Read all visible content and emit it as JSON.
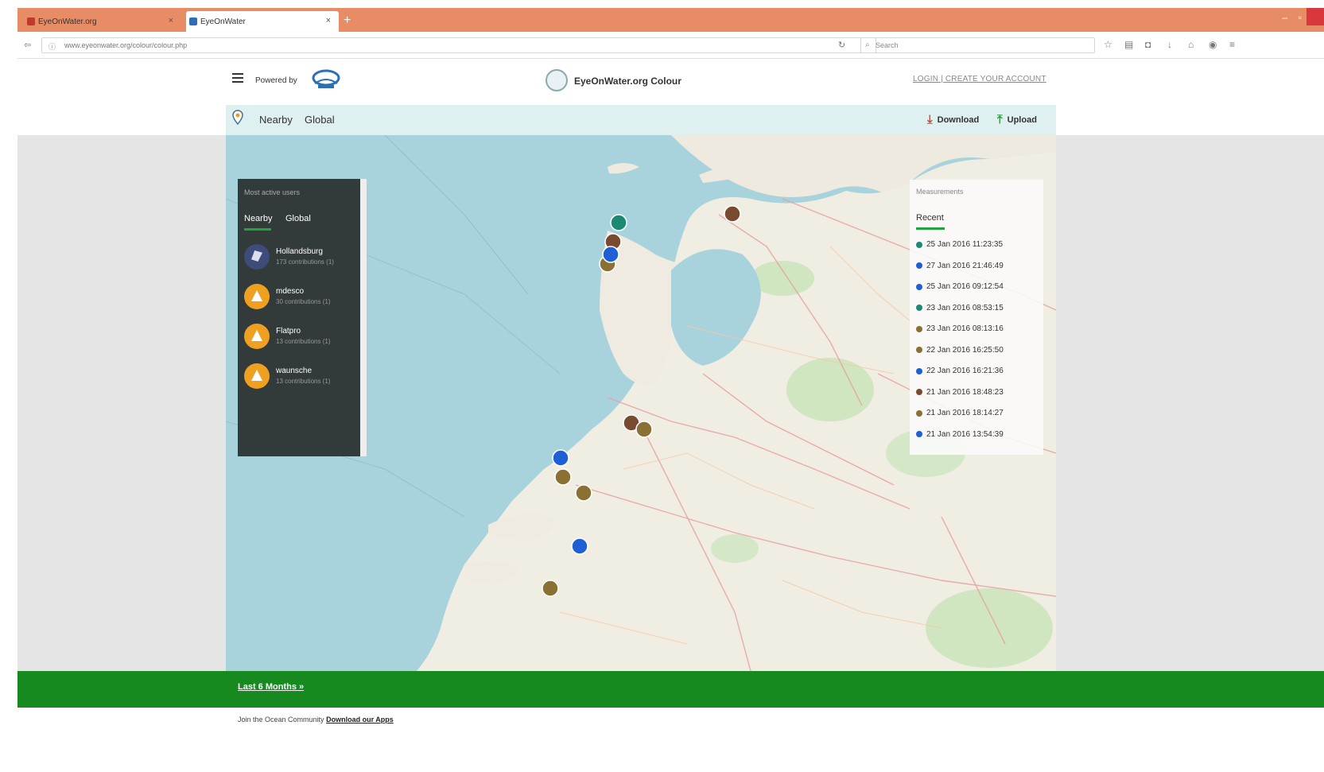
{
  "browser": {
    "tabs": [
      {
        "label": "EyeOnWater.org"
      },
      {
        "label": "EyeOnWater"
      }
    ],
    "url": "www.eyeonwater.org/colour/colour.php",
    "search_placeholder": "Search"
  },
  "header": {
    "powered_by": "Powered by",
    "site_title": "EyeOnWater.org Colour",
    "login_link": "LOGIN | CREATE YOUR ACCOUNT"
  },
  "subnav": {
    "tabs": [
      "Nearby",
      "Global"
    ],
    "download_label": "Download",
    "upload_label": "Upload"
  },
  "contributors_panel": {
    "title": "Most active users",
    "tabs": [
      "Nearby",
      "Global"
    ],
    "users": [
      {
        "name": "Hollandsburg",
        "detail": "173 contributions (1)"
      },
      {
        "name": "mdesco",
        "detail": "30 contributions (1)"
      },
      {
        "name": "Flatpro",
        "detail": "13 contributions (1)"
      },
      {
        "name": "waunsche",
        "detail": "13 contributions (1)"
      }
    ]
  },
  "measurements_panel": {
    "title": "Measurements",
    "tab": "Recent",
    "rows": [
      {
        "time": "25 Jan 2016 11:23:35",
        "color": "#1a8a72"
      },
      {
        "time": "27 Jan 2016 21:46:49",
        "color": "#1f5fd6"
      },
      {
        "time": "25 Jan 2016 09:12:54",
        "color": "#1f5fd6"
      },
      {
        "time": "23 Jan 2016 08:53:15",
        "color": "#1a8a72"
      },
      {
        "time": "23 Jan 2016 08:13:16",
        "color": "#8b7034"
      },
      {
        "time": "22 Jan 2016 16:25:50",
        "color": "#8b7034"
      },
      {
        "time": "22 Jan 2016 16:21:36",
        "color": "#1f5fd6"
      },
      {
        "time": "21 Jan 2016 18:48:23",
        "color": "#7a4a30"
      },
      {
        "time": "21 Jan 2016 18:14:27",
        "color": "#8b7034"
      },
      {
        "time": "21 Jan 2016 13:54:39",
        "color": "#1f5fd6"
      }
    ]
  },
  "map_markers": [
    {
      "color": "#1a8a72"
    },
    {
      "color": "#7a4a30"
    },
    {
      "color": "#1f5fd6"
    },
    {
      "color": "#8b7034"
    }
  ],
  "footer": {
    "link": "Last 6 Months »",
    "note_prefix": "Join the Ocean Community",
    "note_link": "Download our Apps"
  }
}
